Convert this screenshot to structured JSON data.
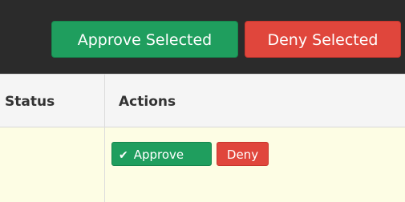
{
  "toolbar": {
    "approve_selected_label": "Approve Selected",
    "deny_selected_label": "Deny Selected"
  },
  "table": {
    "headers": {
      "status": "Status",
      "actions": "Actions"
    },
    "rows": [
      {
        "approve_label": "Approve",
        "deny_label": "Deny"
      }
    ]
  },
  "icons": {
    "approve": "check-icon"
  },
  "colors": {
    "approve_green": "#1f9e5e",
    "deny_red": "#e0463c",
    "toolbar_bg": "#2b2b2b",
    "row_highlight": "#fdfde4"
  }
}
